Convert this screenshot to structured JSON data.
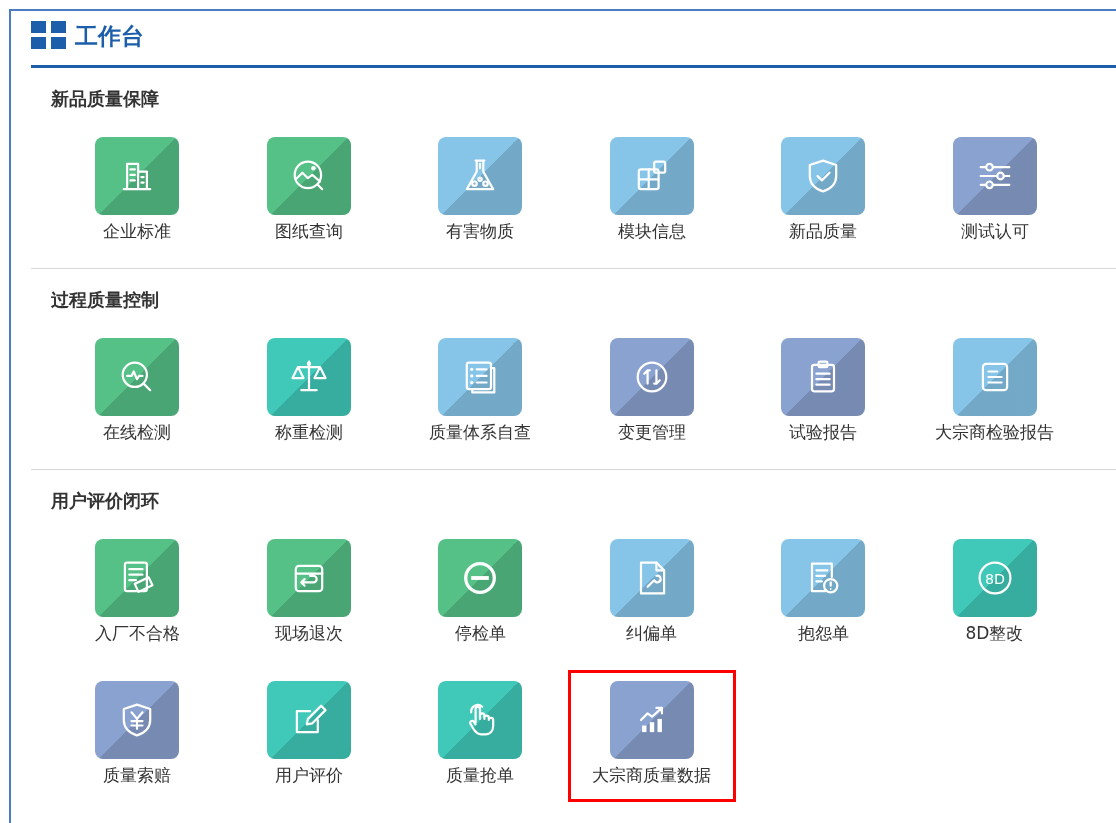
{
  "workspace": {
    "title": "工作台",
    "sections": [
      {
        "title": "新品质量保障",
        "items": [
          {
            "label": "企业标准",
            "kind": "building",
            "color": "#55c187",
            "selected": false
          },
          {
            "label": "图纸查询",
            "kind": "picture",
            "color": "#55c187",
            "selected": false
          },
          {
            "label": "有害物质",
            "kind": "flask",
            "color": "#86c5e8",
            "selected": false
          },
          {
            "label": "模块信息",
            "kind": "blocks",
            "color": "#86c5e8",
            "selected": false
          },
          {
            "label": "新品质量",
            "kind": "shield",
            "color": "#86c5e8",
            "selected": false
          },
          {
            "label": "测试认可",
            "kind": "sliders",
            "color": "#8aa2cf",
            "selected": false
          }
        ]
      },
      {
        "title": "过程质量控制",
        "items": [
          {
            "label": "在线检测",
            "kind": "pulse",
            "color": "#55c187",
            "selected": false
          },
          {
            "label": "称重检测",
            "kind": "scale",
            "color": "#40c9b9",
            "selected": false
          },
          {
            "label": "质量体系自查",
            "kind": "checklist",
            "color": "#86c5e8",
            "selected": false
          },
          {
            "label": "变更管理",
            "kind": "cycle",
            "color": "#8aa2cf",
            "selected": false
          },
          {
            "label": "试验报告",
            "kind": "clipboard",
            "color": "#8aa2cf",
            "selected": false
          },
          {
            "label": "大宗商检验报告",
            "kind": "document",
            "color": "#86c5e8",
            "selected": false
          }
        ]
      },
      {
        "title": "用户评价闭环",
        "items": [
          {
            "label": "入厂不合格",
            "kind": "stamp",
            "color": "#55c187",
            "selected": false
          },
          {
            "label": "现场退次",
            "kind": "inbox",
            "color": "#55c187",
            "selected": false
          },
          {
            "label": "停检单",
            "kind": "minus",
            "color": "#55c187",
            "selected": false
          },
          {
            "label": "纠偏单",
            "kind": "wrench",
            "color": "#86c5e8",
            "selected": false
          },
          {
            "label": "抱怨单",
            "kind": "alert",
            "color": "#86c5e8",
            "selected": false
          },
          {
            "label": "8D整改",
            "kind": "badge",
            "icon_text": "8D",
            "color": "#40c9b9",
            "selected": false
          },
          {
            "label": "质量索赔",
            "kind": "yen",
            "color": "#8aa2cf",
            "selected": false
          },
          {
            "label": "用户评价",
            "kind": "edit",
            "color": "#40c9b9",
            "selected": false
          },
          {
            "label": "质量抢单",
            "kind": "hand",
            "color": "#40c9b9",
            "selected": false
          },
          {
            "label": "大宗商质量数据",
            "kind": "chart",
            "color": "#8aa2cf",
            "selected": true
          }
        ]
      }
    ]
  }
}
